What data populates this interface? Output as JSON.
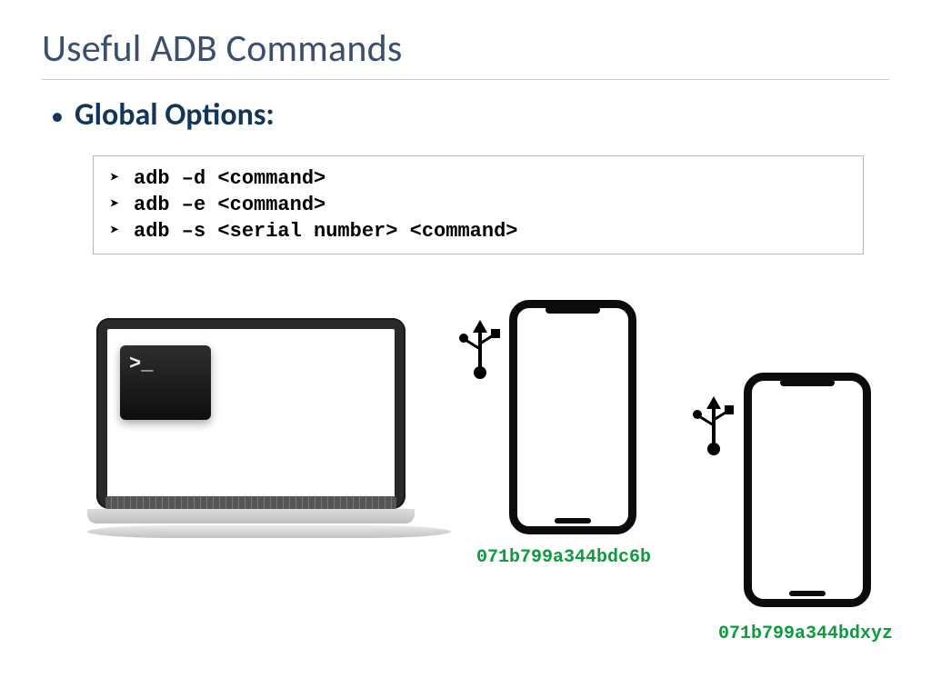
{
  "title": "Useful ADB Commands",
  "bullet_heading": "Global Options:",
  "commands": [
    "adb –d <command>",
    "adb –e <command>",
    "adb –s <serial number> <command>"
  ],
  "terminal_prompt": ">_",
  "devices": [
    {
      "serial": "071b799a344bdc6b"
    },
    {
      "serial": "071b799a344bdxyz"
    }
  ]
}
